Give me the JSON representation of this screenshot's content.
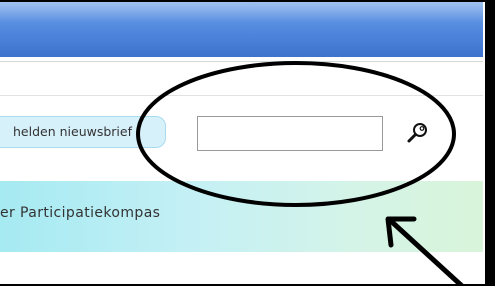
{
  "header": {
    "accent_color": "#4f86dc"
  },
  "toolbar": {
    "newsletter_label": "helden nieuwsbrief",
    "search_placeholder": "",
    "search_value": "",
    "search_icon": "magnifier-icon"
  },
  "banner": {
    "text": "er Participatiekompas",
    "colors": [
      "#a6eaf2",
      "#d8f4d9"
    ]
  },
  "annotation": {
    "shape": "ellipse",
    "pointer": "arrow",
    "color": "#000000"
  }
}
